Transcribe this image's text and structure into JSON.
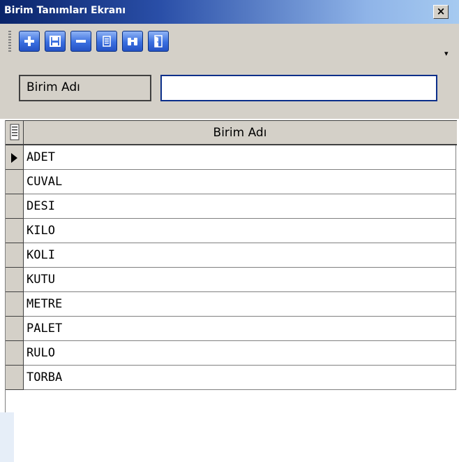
{
  "window": {
    "title": "Birim Tanımları Ekranı",
    "close_glyph": "×"
  },
  "toolbar": {
    "buttons": [
      "add-icon",
      "save-icon",
      "delete-icon",
      "list-icon",
      "binoculars-icon",
      "exit-door-icon"
    ],
    "overflow_glyph": "▾",
    "colors": {
      "button": "#3a6fe0",
      "button_border": "#082e80"
    }
  },
  "filter": {
    "label": "Birim Adı",
    "value": "",
    "placeholder": ""
  },
  "grid": {
    "column_header": "Birim Adı",
    "rows": [
      "ADET",
      "CUVAL",
      "DESI",
      "KILO",
      "KOLI",
      "KUTU",
      "METRE",
      "PALET",
      "RULO",
      "TORBA"
    ],
    "current_row": 0
  }
}
